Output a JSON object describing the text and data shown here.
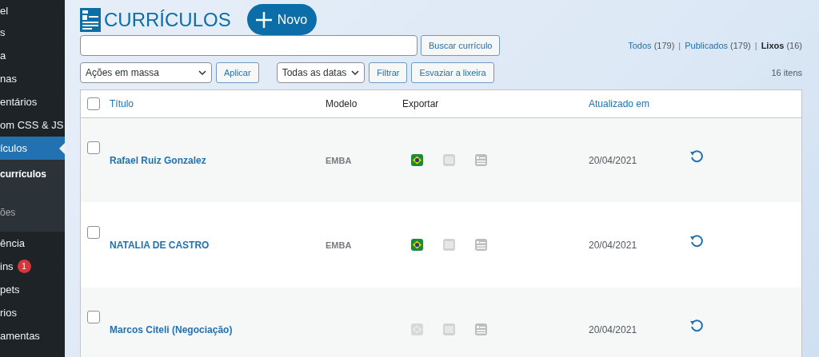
{
  "sidebar": {
    "items": [
      {
        "label": "el",
        "selected": false
      },
      {
        "label": "s",
        "selected": false
      },
      {
        "label": "a",
        "selected": false
      },
      {
        "label": "nas",
        "selected": false
      },
      {
        "label": "entários",
        "selected": false
      },
      {
        "label": "om CSS & JS",
        "selected": false
      },
      {
        "label": "ículos",
        "selected": true,
        "submenu": [
          {
            "label": "currículos",
            "selected": true
          },
          {
            "label": "ões",
            "selected": false
          }
        ]
      },
      {
        "label": "ência",
        "selected": false
      },
      {
        "label": "ins",
        "selected": false,
        "badge": "1"
      },
      {
        "label": "pets",
        "selected": false
      },
      {
        "label": "rios",
        "selected": false
      },
      {
        "label": "amentas",
        "selected": false
      }
    ]
  },
  "header": {
    "title": "CURRÍCULOS",
    "new_button": "Novo"
  },
  "search": {
    "button": "Buscar currículo"
  },
  "view_separator": "|",
  "views": [
    {
      "label": "Todos",
      "count": "(179)",
      "selected": false
    },
    {
      "label": "Publicados",
      "count": "(179)",
      "selected": false
    },
    {
      "label": "Lixos",
      "count": "(16)",
      "selected": true
    }
  ],
  "filters": {
    "bulk_actions": "Ações em massa",
    "apply": "Aplicar",
    "dates": "Todas as datas",
    "filter": "Filtrar",
    "empty_trash": "Esvaziar a lixeira",
    "count": "16 itens"
  },
  "table": {
    "select_all_checked": false,
    "columns": [
      "Título",
      "Modelo",
      "Exportar",
      "Atualizado em"
    ],
    "rows": [
      {
        "title": "Rafael Ruiz Gonzalez",
        "model": "EMBA",
        "date": "20/04/2021",
        "checked": false,
        "exports": [
          {
            "kind": "flag",
            "enabled": true
          },
          {
            "kind": "doc",
            "enabled": false
          },
          {
            "kind": "card",
            "enabled": false
          }
        ]
      },
      {
        "title": "NATALIA DE CASTRO",
        "model": "EMBA",
        "date": "20/04/2021",
        "checked": false,
        "exports": [
          {
            "kind": "flag",
            "enabled": true
          },
          {
            "kind": "doc",
            "enabled": false
          },
          {
            "kind": "card",
            "enabled": false
          }
        ]
      },
      {
        "title": "Marcos Citeli (Negociação)",
        "date": "20/04/2021",
        "checked": false,
        "exports": [
          {
            "kind": "flag",
            "enabled": false
          },
          {
            "kind": "doc",
            "enabled": false
          },
          {
            "kind": "card",
            "enabled": false
          }
        ]
      }
    ]
  }
}
